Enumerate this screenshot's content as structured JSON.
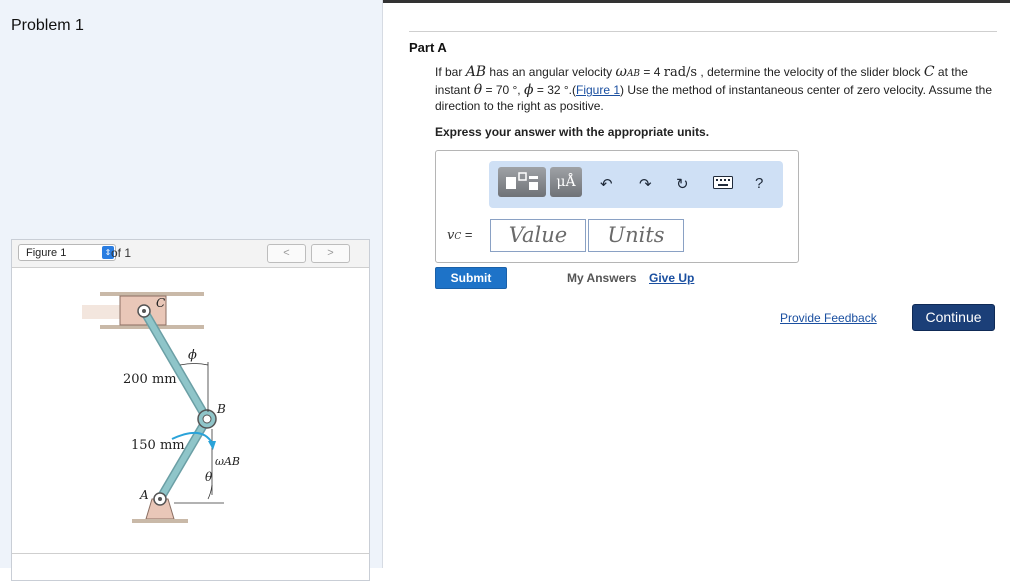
{
  "sidebar": {
    "problem_title": "Problem 1"
  },
  "figure": {
    "selector_value": "Figure 1",
    "of_text": "of 1",
    "prev_label": "<",
    "next_label": ">",
    "labels": {
      "c": "C",
      "phi": "ϕ",
      "dim_200": "200 mm",
      "b": "B",
      "dim_150": "150 mm",
      "omega_ab": "ωAB",
      "theta": "θ",
      "a": "A"
    }
  },
  "part": {
    "title": "Part A"
  },
  "question": {
    "t1": "If bar ",
    "ab": "AB",
    "t2": " has an angular velocity ",
    "omega": "ω",
    "omega_sub": "AB",
    "t3": " = 4 ",
    "unit": "rad/s",
    "t4": " , determine the velocity of the slider block ",
    "c": "C",
    "t5": " at the instant ",
    "theta": "θ",
    "t6": " = 70 °, ",
    "phi": "ϕ",
    "t7": " = 32 °.(",
    "figure_link": "Figure 1",
    "t8": ") Use the method of instantaneous center of zero velocity. Assume the direction to the right as positive."
  },
  "instructions": "Express your answer with the appropriate units.",
  "answer": {
    "toolbar": {
      "units_button": "μÅ",
      "help": "?"
    },
    "variable_label": "vC =",
    "value_placeholder": "Value",
    "units_placeholder": "Units"
  },
  "actions": {
    "submit": "Submit",
    "my_answers": "My Answers",
    "give_up": "Give Up",
    "feedback": "Provide Feedback",
    "continue": "Continue"
  },
  "colors": {
    "accent_blue": "#1e73c8",
    "continue_navy": "#1b3f78",
    "link_blue": "#1a4fa0",
    "toolbar_bg": "#cfe0f5",
    "rod_teal": "#8fc5c9",
    "block_pink": "#e9c7b8",
    "arrow_blue": "#2aa3d9"
  }
}
